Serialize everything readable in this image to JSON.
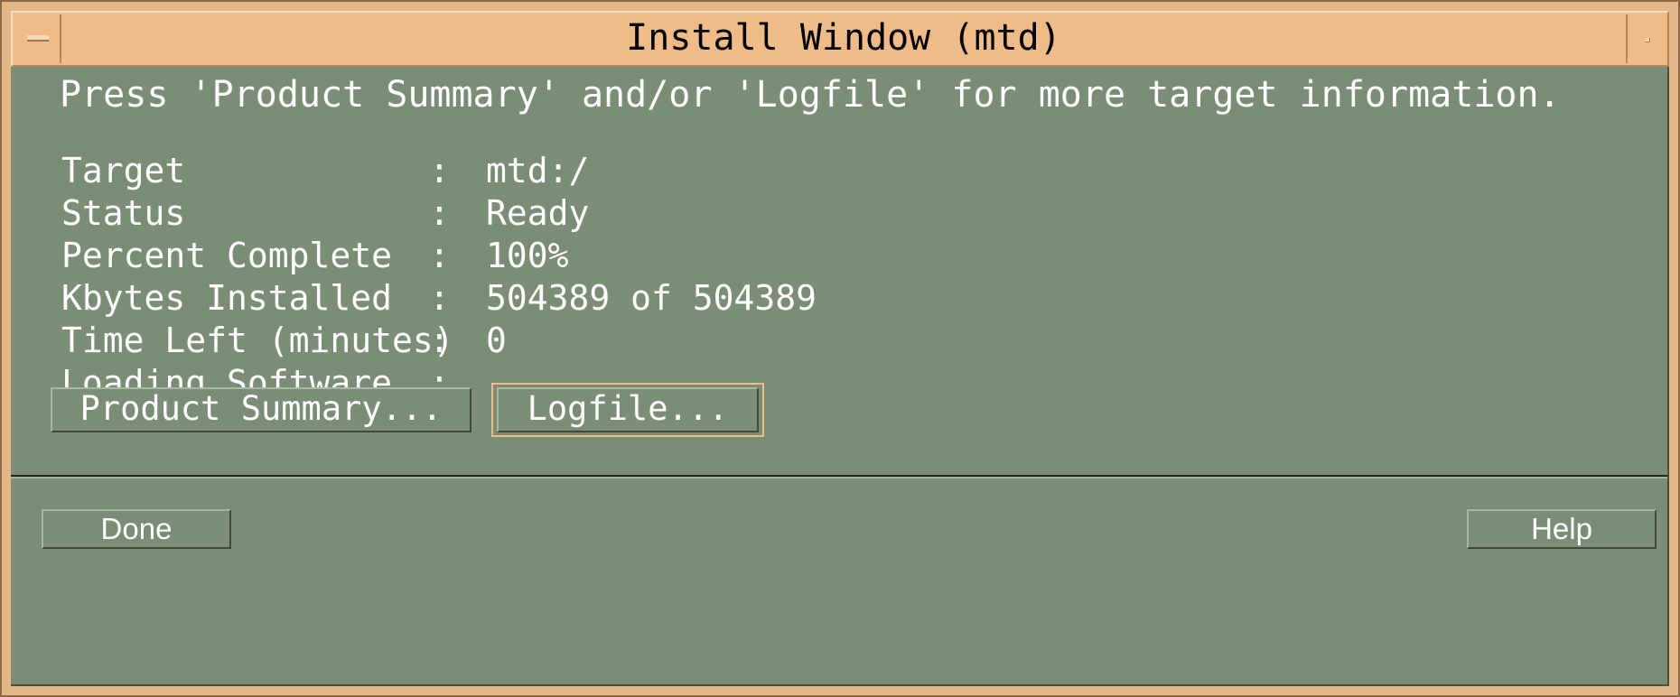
{
  "window": {
    "title": "Install Window (mtd)"
  },
  "instruction": "Press 'Product Summary' and/or 'Logfile' for more target information.",
  "info": {
    "rows": [
      {
        "label": "Target",
        "value": "mtd:/"
      },
      {
        "label": "Status",
        "value": "Ready"
      },
      {
        "label": "Percent Complete",
        "value": "100%"
      },
      {
        "label": "Kbytes Installed",
        "value": "504389 of 504389"
      },
      {
        "label": "Time Left (minutes)",
        "value": "0"
      },
      {
        "label": "Loading Software",
        "value": ""
      }
    ],
    "separator": ":"
  },
  "buttons": {
    "product_summary": "Product Summary...",
    "logfile": "Logfile...",
    "done": "Done",
    "help": "Help"
  },
  "colors": {
    "frame": "#e3b886",
    "title_bar": "#efbb88",
    "panel": "#7b8d77",
    "text": "#ffffff",
    "focus_ring": "#efbb88"
  },
  "icons": {
    "window_menu": "window-menu-icon",
    "maximize": "maximize-icon"
  }
}
